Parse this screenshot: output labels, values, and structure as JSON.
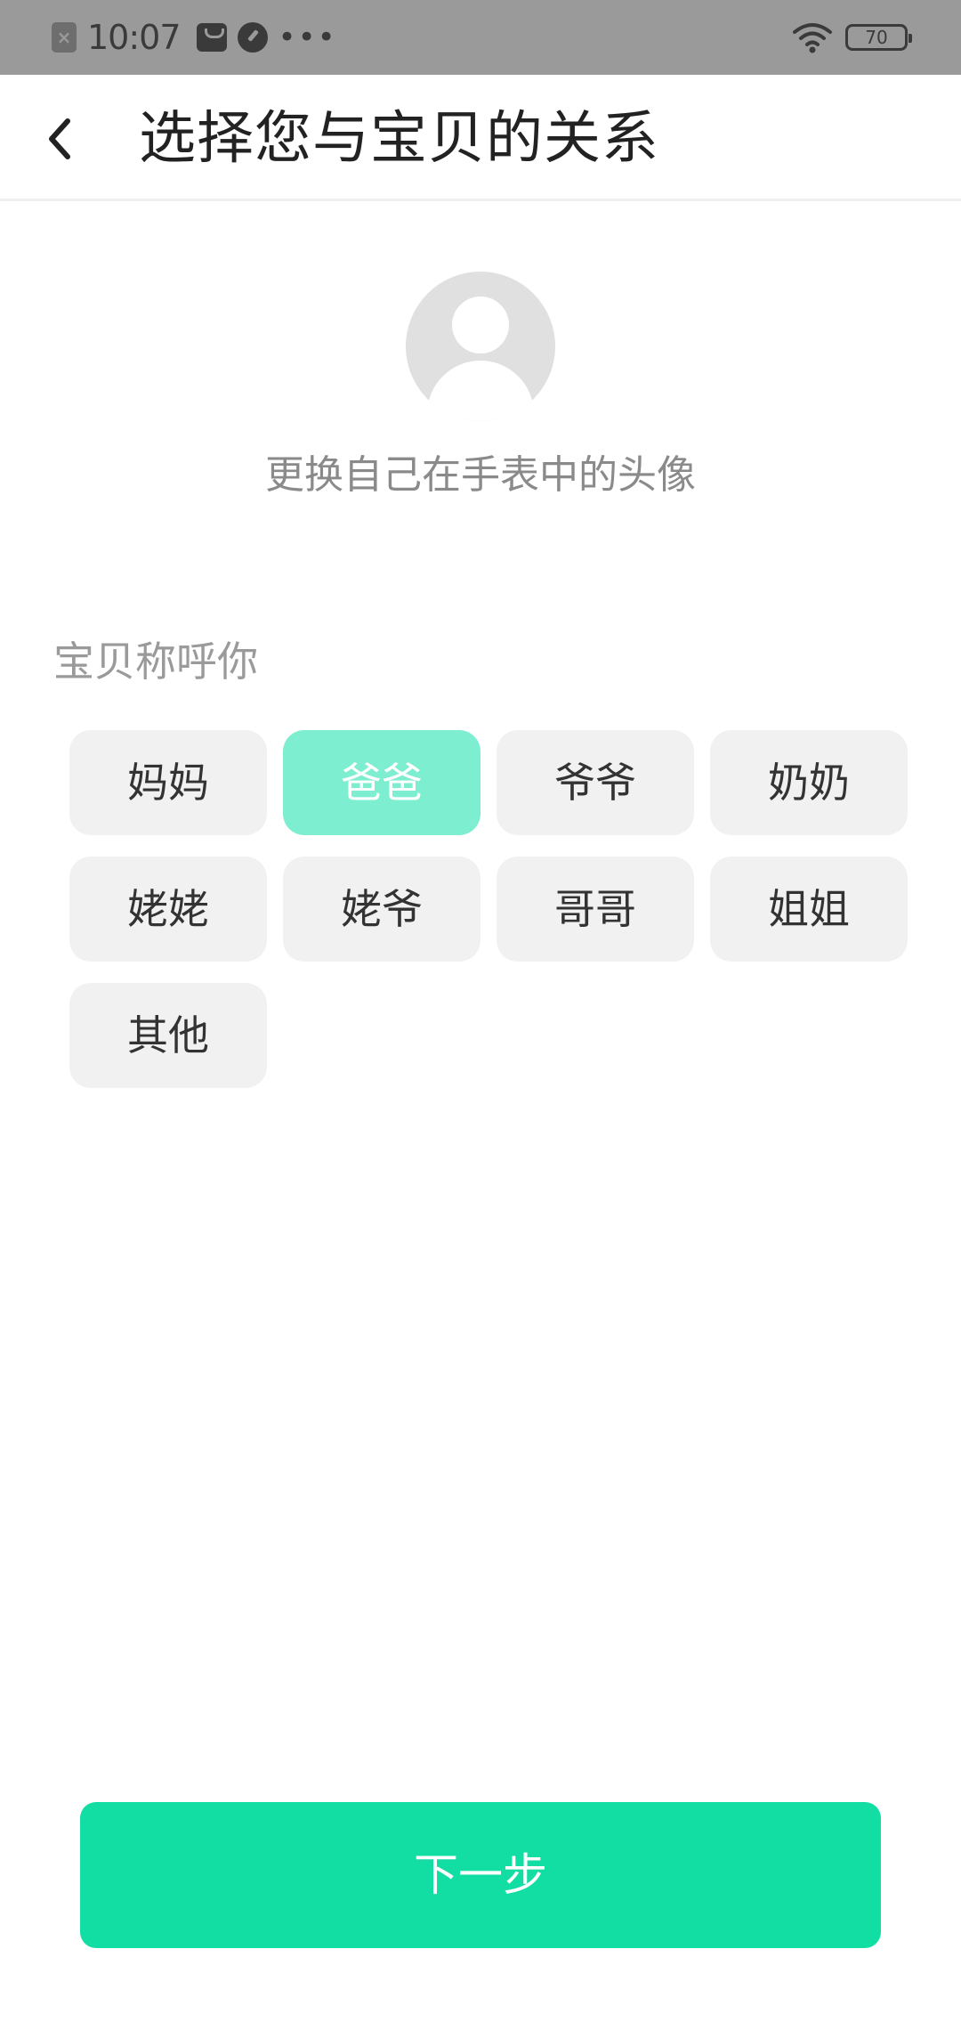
{
  "status_bar": {
    "time": "10:07",
    "dots": "•••",
    "battery": "70",
    "close_glyph": "×"
  },
  "header": {
    "title": "选择您与宝贝的关系"
  },
  "avatar": {
    "caption": "更换自己在手表中的头像"
  },
  "relationship": {
    "label": "宝贝称呼你",
    "selected": "爸爸",
    "options": [
      "妈妈",
      "爸爸",
      "爷爷",
      "奶奶",
      "姥姥",
      "姥爷",
      "哥哥",
      "姐姐",
      "其他"
    ]
  },
  "footer": {
    "next_label": "下一步"
  },
  "colors": {
    "primary": "#12dda2",
    "selected_chip": "#7eeed0",
    "chip": "#f1f1f1",
    "status_bar": "#9a9a9a"
  },
  "icons": {
    "back": "back-arrow-icon",
    "avatar": "user-avatar-icon",
    "wifi": "wifi-icon",
    "battery": "battery-icon"
  }
}
